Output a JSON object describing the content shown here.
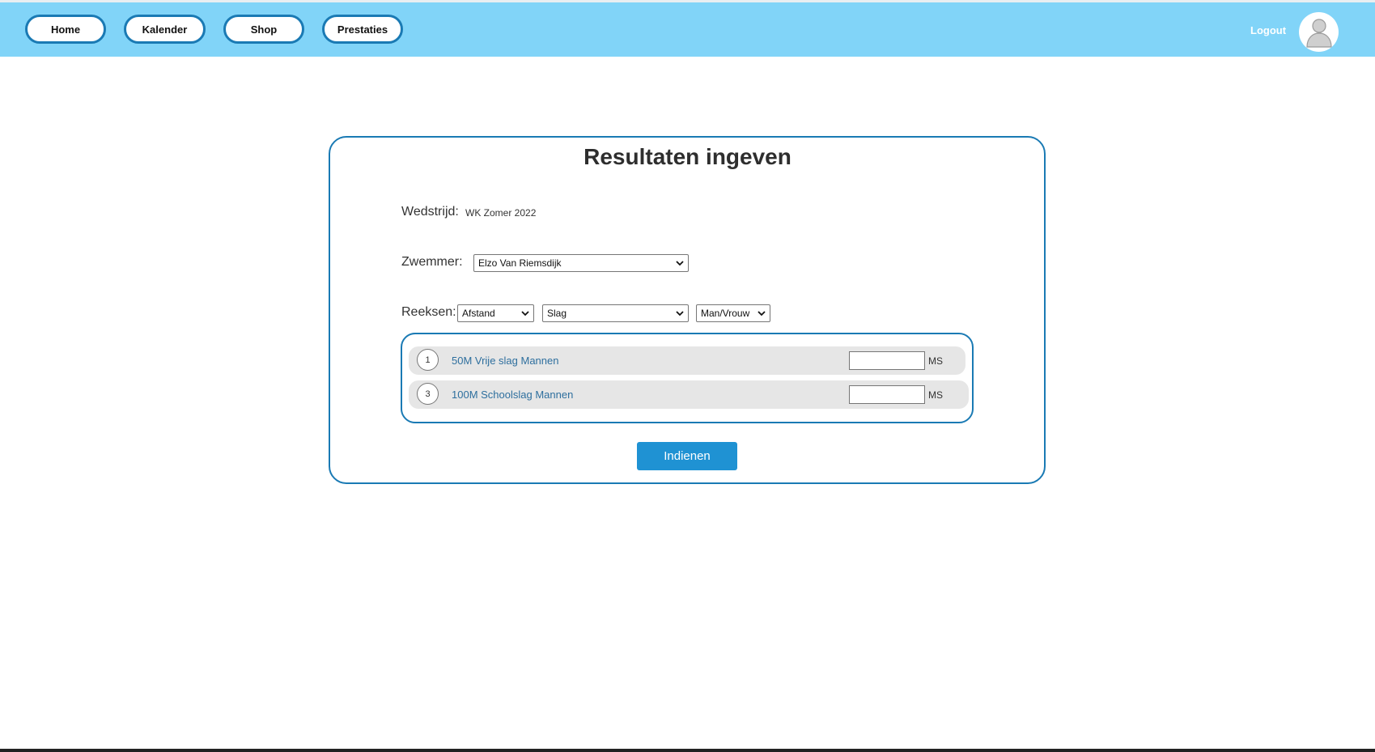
{
  "nav": {
    "items": [
      {
        "label": "Home"
      },
      {
        "label": "Kalender"
      },
      {
        "label": "Shop"
      },
      {
        "label": "Prestaties"
      }
    ],
    "logout_label": "Logout",
    "avatar_icon": "user-avatar-icon"
  },
  "form": {
    "title": "Resultaten ingeven",
    "wedstrijd_label": "Wedstrijd:",
    "wedstrijd_value": "WK Zomer 2022",
    "zwemmer_label": "Zwemmer:",
    "zwemmer_selected": "Elzo Van Riemsdijk",
    "reeksen_label": "Reeksen:",
    "filters": {
      "afstand": "Afstand",
      "slag": "Slag",
      "geslacht": "Man/Vrouw"
    },
    "rows": [
      {
        "number": "1",
        "label": "50M Vrije slag Mannen",
        "time_value": "",
        "unit": "MS"
      },
      {
        "number": "3",
        "label": "100M Schoolslag Mannen",
        "time_value": "",
        "unit": "MS"
      }
    ],
    "submit_label": "Indienen"
  },
  "colors": {
    "navbar": "#81d4f8",
    "accent_border": "#1a7ab4",
    "submit_button": "#1f92d3",
    "row_background": "#e6e6e6"
  }
}
